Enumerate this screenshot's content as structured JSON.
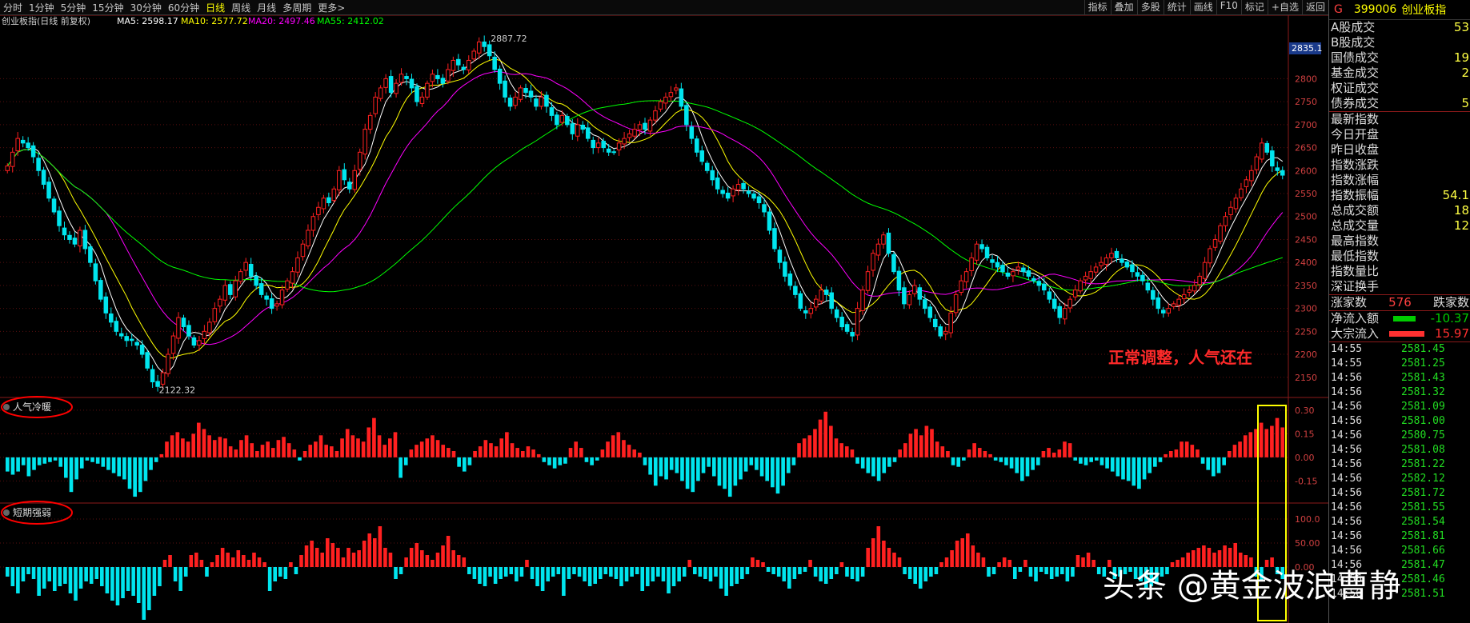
{
  "toolbar": {
    "periods": [
      "分时",
      "1分钟",
      "5分钟",
      "15分钟",
      "30分钟",
      "60分钟",
      "日线",
      "周线",
      "月线",
      "多周期",
      "更多>"
    ],
    "active": "日线",
    "right_items": [
      "指标",
      "叠加",
      "多股",
      "统计",
      "画线",
      "F10",
      "标记",
      "+自选",
      "返回"
    ]
  },
  "chart_data": [
    {
      "type": "candlestick",
      "title": "创业板指(日线 前复权)",
      "ma_labels": [
        {
          "text": "MA5: 2598.17",
          "color": "#ffffff"
        },
        {
          "text": "MA10: 2577.72",
          "color": "#ffff00"
        },
        {
          "text": "MA20: 2497.46",
          "color": "#ff00ff"
        },
        {
          "text": "MA55: 2412.02",
          "color": "#00ff00"
        }
      ],
      "y_ticks": [
        2150,
        2200,
        2250,
        2300,
        2350,
        2400,
        2450,
        2500,
        2550,
        2600,
        2650,
        2700,
        2750,
        2800
      ],
      "ylim": [
        2120,
        2900
      ],
      "current_price_tag": "2835.1",
      "annotations": [
        {
          "text": "2887.72",
          "x_index": 92,
          "value": 2887.72
        },
        {
          "text": "2122.32",
          "x_index": 28,
          "value": 2122.32
        }
      ],
      "note": "正常调整，人气还在",
      "close": [
        2610,
        2640,
        2670,
        2660,
        2650,
        2630,
        2600,
        2570,
        2540,
        2510,
        2480,
        2460,
        2450,
        2440,
        2470,
        2430,
        2400,
        2360,
        2320,
        2290,
        2270,
        2250,
        2240,
        2230,
        2230,
        2220,
        2200,
        2170,
        2140,
        2130,
        2160,
        2200,
        2240,
        2280,
        2260,
        2240,
        2220,
        2230,
        2250,
        2270,
        2300,
        2320,
        2350,
        2330,
        2360,
        2380,
        2400,
        2370,
        2350,
        2330,
        2320,
        2300,
        2310,
        2340,
        2360,
        2380,
        2410,
        2440,
        2470,
        2500,
        2520,
        2540,
        2530,
        2560,
        2600,
        2580,
        2560,
        2600,
        2640,
        2690,
        2720,
        2760,
        2780,
        2800,
        2770,
        2790,
        2810,
        2800,
        2780,
        2750,
        2760,
        2790,
        2810,
        2800,
        2790,
        2820,
        2840,
        2830,
        2820,
        2840,
        2860,
        2880,
        2870,
        2850,
        2820,
        2790,
        2760,
        2740,
        2760,
        2780,
        2770,
        2760,
        2740,
        2760,
        2740,
        2720,
        2700,
        2720,
        2700,
        2680,
        2700,
        2690,
        2670,
        2650,
        2660,
        2650,
        2640,
        2640,
        2660,
        2670,
        2680,
        2690,
        2700,
        2690,
        2710,
        2730,
        2750,
        2760,
        2770,
        2780,
        2740,
        2700,
        2670,
        2640,
        2620,
        2600,
        2580,
        2560,
        2550,
        2540,
        2560,
        2570,
        2560,
        2550,
        2540,
        2530,
        2510,
        2470,
        2430,
        2400,
        2370,
        2350,
        2330,
        2300,
        2290,
        2300,
        2320,
        2340,
        2330,
        2300,
        2280,
        2260,
        2250,
        2240,
        2300,
        2340,
        2380,
        2420,
        2440,
        2460,
        2420,
        2380,
        2340,
        2310,
        2330,
        2350,
        2320,
        2300,
        2280,
        2260,
        2240,
        2250,
        2290,
        2330,
        2360,
        2380,
        2410,
        2440,
        2430,
        2410,
        2400,
        2390,
        2380,
        2370,
        2380,
        2390,
        2380,
        2370,
        2360,
        2350,
        2340,
        2320,
        2300,
        2280,
        2300,
        2320,
        2340,
        2360,
        2370,
        2380,
        2390,
        2400,
        2410,
        2420,
        2410,
        2400,
        2390,
        2380,
        2370,
        2360,
        2340,
        2320,
        2300,
        2290,
        2300,
        2310,
        2320,
        2330,
        2340,
        2350,
        2370,
        2400,
        2430,
        2450,
        2480,
        2500,
        2520,
        2540,
        2560,
        2580,
        2600,
        2630,
        2660,
        2640,
        2610,
        2600,
        2590
      ]
    },
    {
      "type": "bar",
      "title": "人气冷暖",
      "y_ticks": [
        0.3,
        0.15,
        0.0,
        -0.15
      ],
      "ylim": [
        -0.28,
        0.36
      ],
      "values": [
        -0.09,
        -0.11,
        -0.09,
        -0.05,
        -0.12,
        -0.08,
        -0.05,
        -0.04,
        -0.03,
        -0.02,
        -0.06,
        -0.13,
        -0.22,
        -0.14,
        -0.07,
        -0.02,
        -0.03,
        -0.04,
        -0.06,
        -0.08,
        -0.1,
        -0.12,
        -0.14,
        -0.2,
        -0.25,
        -0.22,
        -0.15,
        -0.08,
        -0.03,
        0.02,
        0.1,
        0.14,
        0.16,
        0.12,
        0.1,
        0.15,
        0.22,
        0.18,
        0.14,
        0.11,
        0.13,
        0.12,
        0.07,
        0.05,
        0.11,
        0.14,
        0.09,
        0.04,
        0.08,
        0.1,
        0.06,
        0.11,
        0.13,
        0.09,
        0.05,
        -0.02,
        0.04,
        0.08,
        0.1,
        0.14,
        0.08,
        0.07,
        0.04,
        0.12,
        0.18,
        0.14,
        0.12,
        0.1,
        0.19,
        0.25,
        0.14,
        0.08,
        0.12,
        0.16,
        -0.13,
        -0.05,
        0.05,
        0.08,
        0.1,
        0.12,
        0.14,
        0.11,
        0.08,
        0.06,
        0.04,
        -0.06,
        -0.09,
        -0.05,
        0.04,
        0.07,
        0.11,
        0.09,
        0.07,
        0.12,
        0.16,
        0.09,
        0.06,
        0.04,
        0.07,
        0.05,
        0.02,
        -0.03,
        -0.05,
        -0.07,
        -0.05,
        -0.04,
        0.06,
        0.1,
        0.06,
        -0.03,
        -0.05,
        -0.02,
        0.05,
        0.1,
        0.14,
        0.16,
        0.11,
        0.08,
        0.05,
        0.03,
        -0.05,
        -0.11,
        -0.18,
        -0.12,
        -0.14,
        -0.08,
        -0.1,
        -0.15,
        -0.2,
        -0.22,
        -0.15,
        -0.1,
        -0.06,
        -0.12,
        -0.18,
        -0.2,
        -0.25,
        -0.18,
        -0.14,
        -0.09,
        -0.05,
        -0.08,
        -0.12,
        -0.15,
        -0.19,
        -0.23,
        -0.18,
        -0.1,
        -0.05,
        0.09,
        0.12,
        0.14,
        0.18,
        0.24,
        0.29,
        0.2,
        0.12,
        0.09,
        0.07,
        0.05,
        -0.04,
        -0.07,
        -0.1,
        -0.12,
        -0.15,
        -0.1,
        -0.06,
        -0.03,
        0.05,
        0.09,
        0.15,
        0.18,
        0.14,
        0.2,
        0.18,
        0.1,
        0.07,
        0.04,
        -0.05,
        -0.06,
        -0.02,
        0.05,
        0.09,
        0.06,
        0.04,
        0.02,
        -0.02,
        -0.03,
        -0.05,
        -0.07,
        -0.1,
        -0.15,
        -0.12,
        -0.08,
        -0.05,
        0.04,
        0.06,
        0.03,
        0.05,
        0.1,
        0.09,
        -0.02,
        -0.04,
        -0.05,
        -0.03,
        -0.02,
        -0.05,
        -0.07,
        -0.09,
        -0.12,
        -0.14,
        -0.15,
        -0.18,
        -0.2,
        -0.14,
        -0.1,
        -0.06,
        -0.03,
        0.02,
        0.04,
        0.05,
        0.1,
        0.1,
        0.08,
        0.05,
        -0.04,
        -0.08,
        -0.12,
        -0.1,
        -0.05,
        0.04,
        0.08,
        0.1,
        0.14,
        0.16,
        0.18,
        0.22,
        0.18,
        0.2,
        0.25,
        0.19
      ]
    },
    {
      "type": "bar",
      "title": "短期强弱",
      "y_ticks": [
        100.0,
        50.0,
        0.0
      ],
      "ylim": [
        -110,
        120
      ],
      "values": [
        -20,
        -40,
        -55,
        -30,
        -15,
        -25,
        -60,
        -45,
        -30,
        -50,
        -40,
        -35,
        -55,
        -70,
        -45,
        -30,
        -35,
        -25,
        -40,
        -55,
        -70,
        -80,
        -65,
        -50,
        -60,
        -75,
        -110,
        -90,
        -60,
        -40,
        15,
        25,
        -30,
        -50,
        -20,
        25,
        30,
        15,
        -20,
        10,
        25,
        40,
        30,
        20,
        35,
        25,
        15,
        30,
        20,
        10,
        -50,
        -30,
        -20,
        -25,
        10,
        -15,
        25,
        45,
        55,
        40,
        30,
        60,
        50,
        40,
        20,
        40,
        30,
        35,
        55,
        70,
        60,
        85,
        40,
        30,
        -25,
        -15,
        20,
        40,
        50,
        35,
        25,
        15,
        30,
        45,
        65,
        35,
        25,
        20,
        -15,
        -25,
        -35,
        -40,
        -20,
        -35,
        -25,
        -20,
        -15,
        -30,
        -20,
        15,
        -25,
        -40,
        -50,
        -30,
        -20,
        -15,
        -60,
        -25,
        -15,
        -20,
        -30,
        -40,
        -35,
        -25,
        -15,
        -20,
        -25,
        -40,
        -30,
        -20,
        -15,
        -50,
        -40,
        -30,
        -20,
        -30,
        -55,
        -40,
        -30,
        -20,
        15,
        -15,
        -20,
        -25,
        -30,
        -20,
        -45,
        -60,
        -40,
        -35,
        -25,
        -15,
        20,
        15,
        10,
        -10,
        -15,
        -20,
        -30,
        -45,
        -25,
        -15,
        -10,
        15,
        -20,
        -30,
        -35,
        -25,
        -15,
        10,
        -20,
        -25,
        -30,
        -20,
        40,
        60,
        85,
        55,
        40,
        30,
        20,
        -15,
        -25,
        -35,
        -45,
        -30,
        -20,
        -15,
        10,
        20,
        35,
        55,
        60,
        70,
        45,
        30,
        20,
        -20,
        -15,
        10,
        20,
        15,
        -25,
        -10,
        15,
        -20,
        -30,
        -10,
        -15,
        -25,
        -20,
        -15,
        -30,
        -20,
        25,
        20,
        30,
        15,
        -15,
        -20,
        15,
        -25,
        -20,
        -15,
        -10,
        -25,
        -30,
        -45,
        -40,
        -35,
        -20,
        -15,
        10,
        15,
        20,
        30,
        35,
        40,
        45,
        40,
        30,
        35,
        45,
        40,
        50,
        30,
        25,
        20,
        -20,
        -30,
        15,
        20,
        -15,
        -25
      ]
    }
  ],
  "right_panel": {
    "code": "G",
    "index_code": "399006",
    "index_name": "创业板指",
    "rows1": [
      {
        "label": "A股成交",
        "value": "53"
      },
      {
        "label": "B股成交",
        "value": ""
      },
      {
        "label": "国债成交",
        "value": "19"
      },
      {
        "label": "基金成交",
        "value": "2"
      },
      {
        "label": "权证成交",
        "value": ""
      },
      {
        "label": "债券成交",
        "value": "5"
      }
    ],
    "rows2": [
      {
        "label": "最新指数",
        "value": ""
      },
      {
        "label": "今日开盘",
        "value": ""
      },
      {
        "label": "昨日收盘",
        "value": ""
      },
      {
        "label": "指数涨跌",
        "value": ""
      },
      {
        "label": "指数涨幅",
        "value": ""
      },
      {
        "label": "指数振幅",
        "value": "54.1"
      },
      {
        "label": "总成交额",
        "value": "18"
      },
      {
        "label": "总成交量",
        "value": "12"
      },
      {
        "label": "最高指数",
        "value": ""
      },
      {
        "label": "最低指数",
        "value": ""
      },
      {
        "label": "指数量比",
        "value": ""
      },
      {
        "label": "深证换手",
        "value": ""
      }
    ],
    "up_label": "涨家数",
    "up_count": "576",
    "down_label": "跌家数",
    "flow": [
      {
        "label": "净流入额",
        "value": "-10.37",
        "color": "#00cc00"
      },
      {
        "label": "大宗流入",
        "value": "15.97",
        "color": "#ff3030"
      }
    ],
    "ticks": [
      {
        "time": "14:55",
        "price": "2581.45"
      },
      {
        "time": "14:55",
        "price": "2581.25"
      },
      {
        "time": "14:56",
        "price": "2581.43"
      },
      {
        "time": "14:56",
        "price": "2581.32"
      },
      {
        "time": "14:56",
        "price": "2581.09"
      },
      {
        "time": "14:56",
        "price": "2581.00"
      },
      {
        "time": "14:56",
        "price": "2580.75"
      },
      {
        "time": "14:56",
        "price": "2581.08"
      },
      {
        "time": "14:56",
        "price": "2581.22"
      },
      {
        "time": "14:56",
        "price": "2582.12"
      },
      {
        "time": "14:56",
        "price": "2581.72"
      },
      {
        "time": "14:56",
        "price": "2581.55"
      },
      {
        "time": "14:56",
        "price": "2581.54"
      },
      {
        "time": "14:56",
        "price": "2581.81"
      },
      {
        "time": "14:56",
        "price": "2581.66"
      },
      {
        "time": "14:56",
        "price": "2581.47"
      },
      {
        "time": "14:56",
        "price": "2581.46"
      },
      {
        "time": "14:56",
        "price": "2581.51"
      }
    ]
  },
  "watermark": "头条 @黄金波浪曹静",
  "colors": {
    "up": "#ff2020",
    "down": "#00e5ee",
    "ma5": "#ffffff",
    "ma10": "#ffff00",
    "ma20": "#ff00ff",
    "ma55": "#00ff00"
  }
}
